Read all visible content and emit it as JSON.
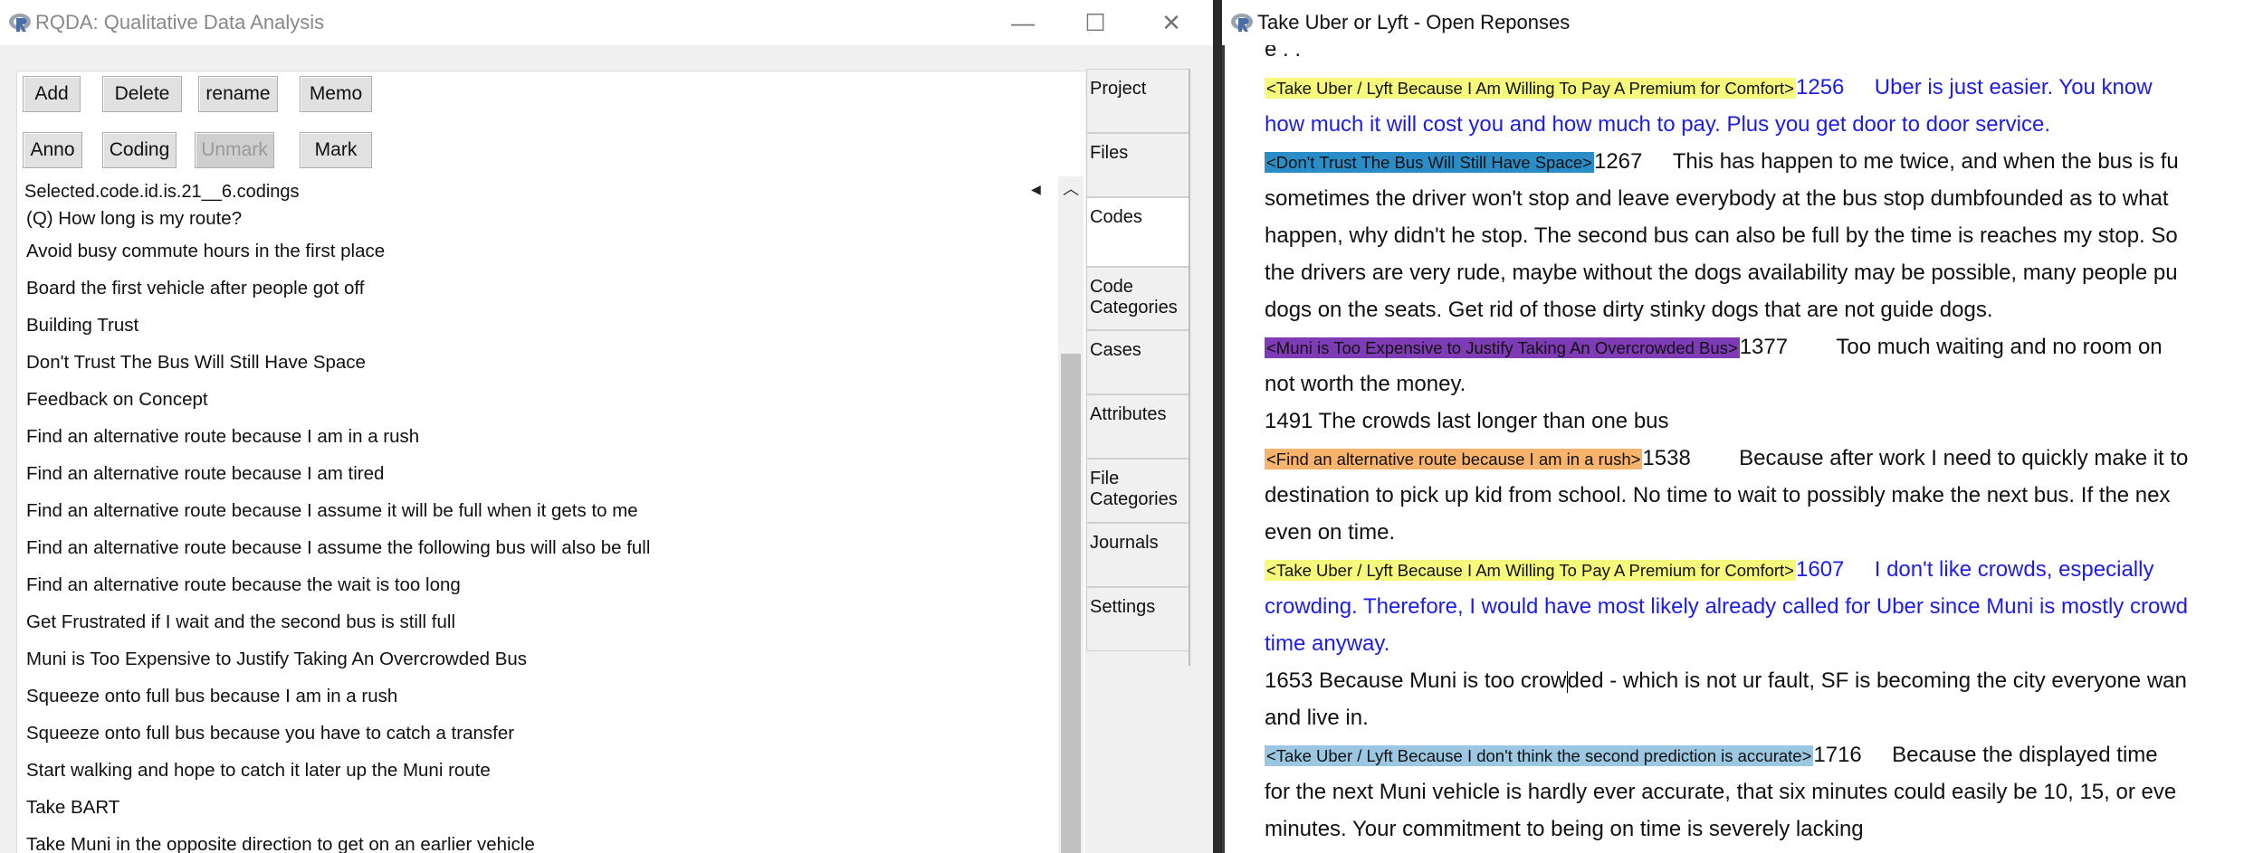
{
  "left_window": {
    "title": "RQDA: Qualitative Data Analysis",
    "controls": {
      "minimize": "—",
      "maximize": "☐",
      "close": "✕"
    },
    "buttons_row1": [
      "Add",
      "Delete",
      "rename",
      "Memo"
    ],
    "buttons_row2": [
      "Anno",
      "Coding",
      "Unmark",
      "Mark"
    ],
    "selected_label": "Selected.code.id.is.21__6.codings",
    "codes": [
      "(Q) How long is my route?",
      "Avoid busy commute hours in the first place",
      "Board the first vehicle after people got off",
      "Building Trust",
      "Don't Trust The Bus Will Still Have Space",
      "Feedback on Concept",
      "Find an alternative route because I am in a rush",
      "Find an alternative route because I am tired",
      "Find an alternative route because I assume it will be full when it gets to me",
      "Find an alternative route because I assume the following bus will also be full",
      "Find an alternative route because the wait is too long",
      "Get Frustrated if I wait and the second bus is still full",
      "Muni is Too Expensive to Justify Taking An Overcrowded Bus",
      "Squeeze onto full bus because I am in a rush",
      "Squeeze onto full bus because you have to catch a transfer",
      "Start walking and hope to catch it later up the Muni route",
      "Take BART",
      "Take Muni in the opposite direction to get on an earlier vehicle"
    ],
    "tabs": [
      "Project",
      "Files",
      "Codes",
      "Code Categories",
      "Cases",
      "Attributes",
      "File Categories",
      "Journals",
      "Settings"
    ],
    "active_tab": "Codes"
  },
  "right_window": {
    "title": "Take Uber or Lyft - Open Reponses",
    "lines": {
      "l0": "e   .         .",
      "l1_mark": "<Take Uber / Lyft Because I Am Willing To Pay A Premium for Comfort>",
      "l1_num": "1256",
      "l1_text": "Uber is just easier. You know",
      "l2_text": "how much it will cost you and how much to pay. Plus you get door to door service.",
      "l3_mark": "<Don't Trust The Bus Will Still Have Space>",
      "l3_num": "1267",
      "l3_text": "This has happen to me twice, and when the bus is fu",
      "l4": "sometimes the driver won't stop and leave everybody at the bus stop dumbfounded as to what",
      "l5": "happen, why didn't he stop. The second bus can also be full by the time is reaches my stop. So",
      "l6": "the drivers are very rude, maybe without the dogs availability may be possible, many people pu",
      "l7": "dogs on the seats. Get rid of those dirty stinky dogs that are not guide dogs.",
      "l8_mark": "<Muni is Too Expensive to Justify Taking An Overcrowded Bus>",
      "l8_num": "1377",
      "l8_text": "Too much waiting and no room on",
      "l9": "not worth the money.",
      "l10": "1491  The crowds last longer than one bus",
      "l11_mark": "<Find an alternative route because I am in a rush>",
      "l11_num": "1538",
      "l11_text": "Because after work I need to quickly make it to",
      "l12": "destination to pick up kid from school. No time to wait to possibly make the next bus. If the nex",
      "l13": "even on time.",
      "l14_mark": "<Take Uber / Lyft Because I Am Willing To Pay A Premium for Comfort>",
      "l14_num": "1607",
      "l14_text": "I don't like crowds, especially",
      "l15_text": "crowding. Therefore, I would have most likely already called for Uber since Muni is mostly crowd",
      "l16_text": "time anyway.",
      "l17_a": "1653  Because Muni is too crow",
      "l17_b": "ded - which is not ur fault, SF is becoming the city everyone wan",
      "l18": "and live in.",
      "l19_mark": "<Take Uber / Lyft Because I don't think the second prediction is accurate>",
      "l19_num": "1716",
      "l19_text": "Because the displayed time",
      "l20": "for the next Muni vehicle is hardly ever accurate, that six minutes could easily be 10, 15, or eve",
      "l21": "minutes.  Your commitment to being on time is severely lacking"
    }
  }
}
